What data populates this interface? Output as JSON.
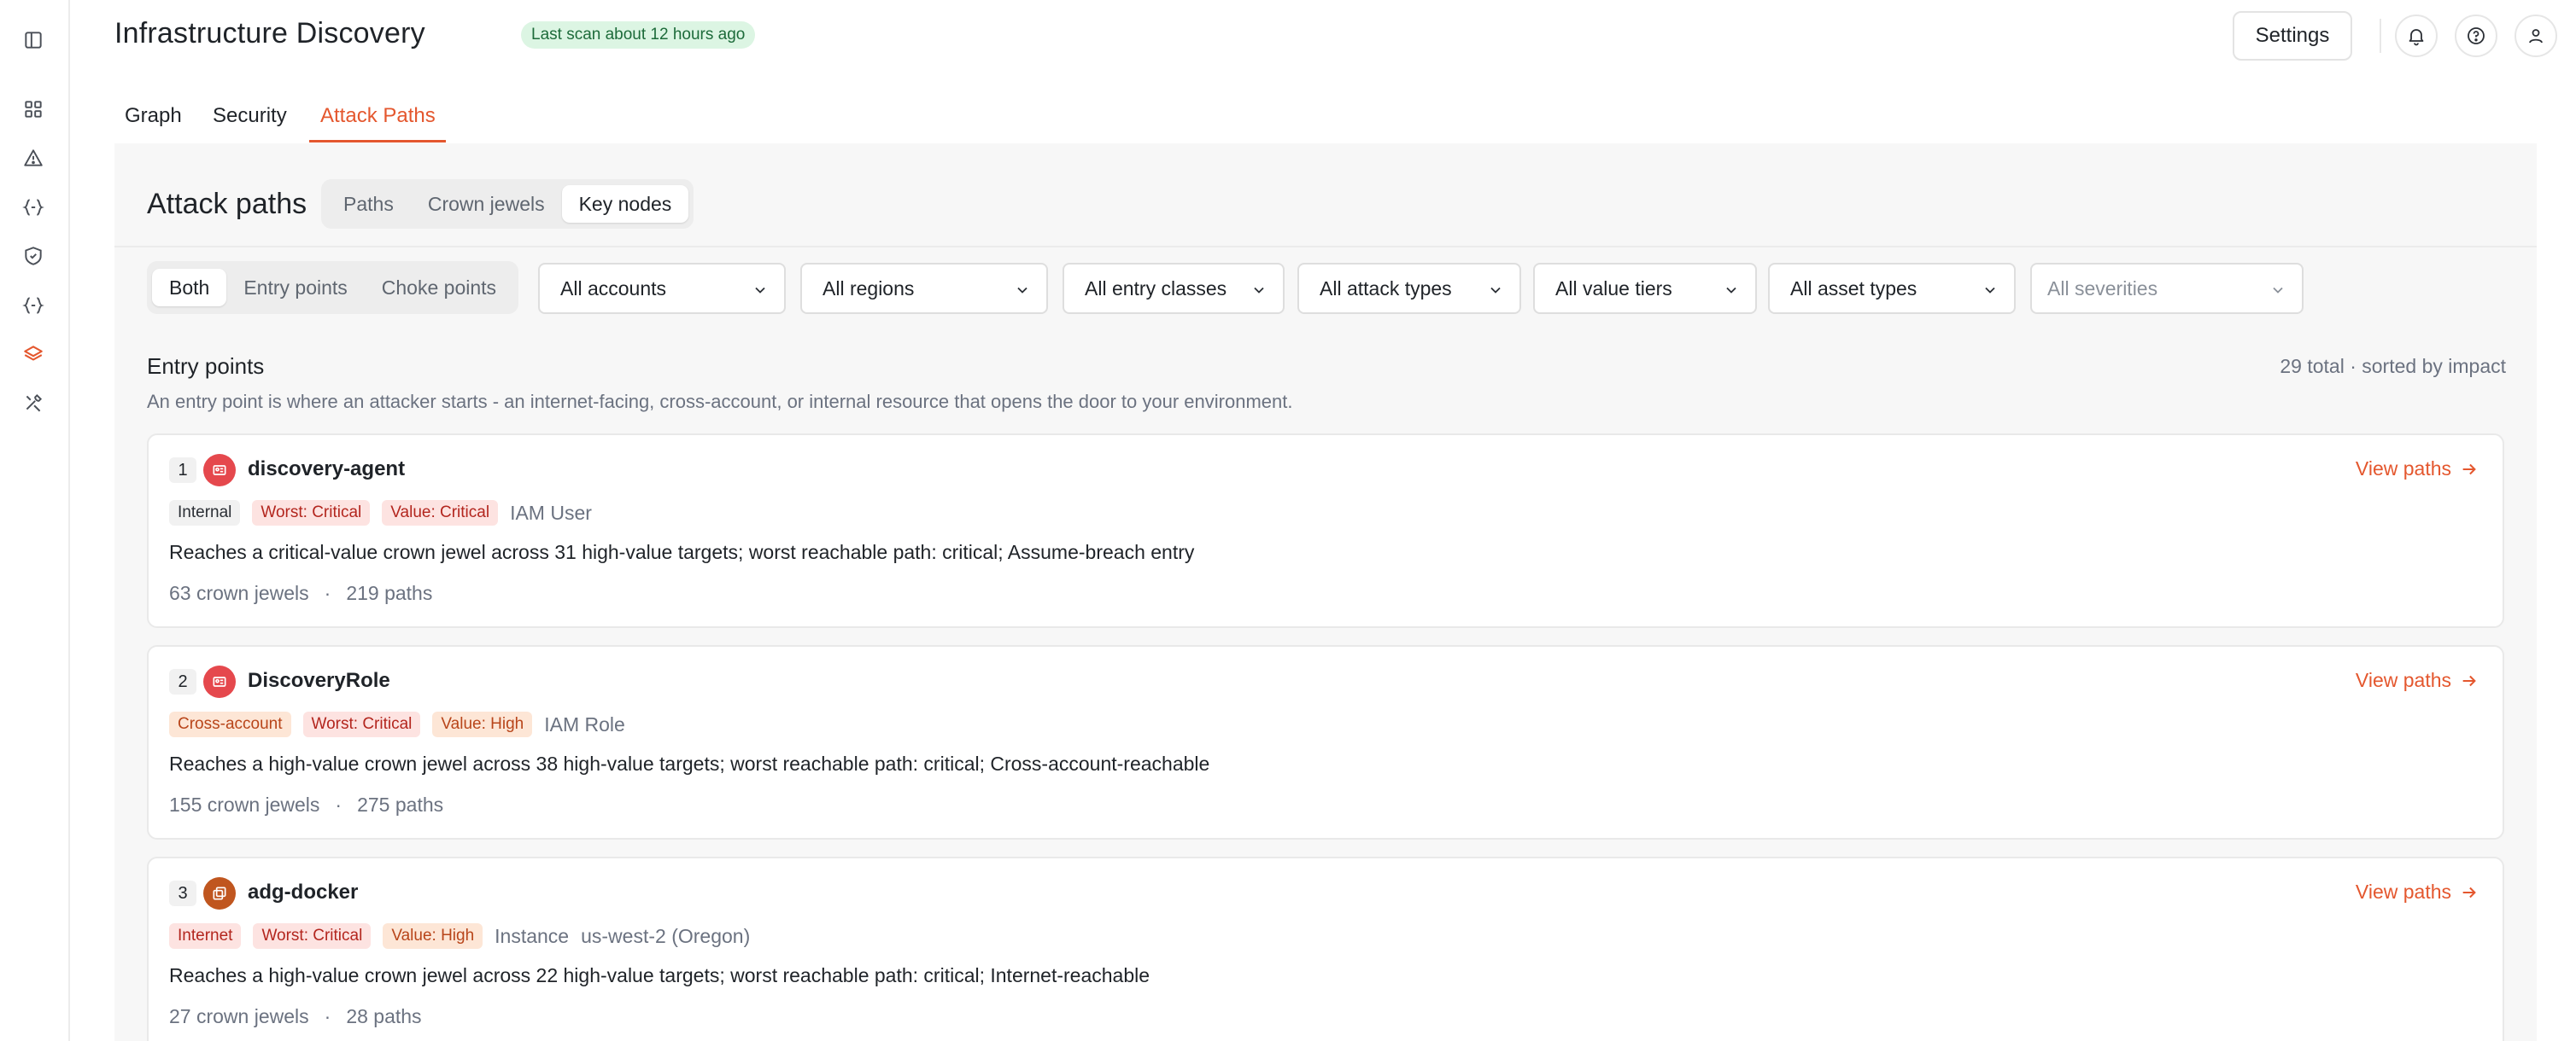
{
  "header": {
    "title": "Infrastructure Discovery",
    "scan_badge": "Last scan about 12 hours ago",
    "settings_label": "Settings"
  },
  "sidebar": {
    "icons": [
      "panel-toggle-icon",
      "dashboard-icon",
      "alert-triangle-icon",
      "code-braces-icon",
      "shield-icon",
      "code-braces-icon",
      "layers-icon",
      "tools-icon"
    ]
  },
  "tabs": [
    {
      "label": "Graph",
      "active": false
    },
    {
      "label": "Security",
      "active": false
    },
    {
      "label": "Attack Paths",
      "active": true
    }
  ],
  "panel": {
    "title": "Attack paths",
    "view_options": [
      {
        "label": "Paths",
        "selected": false
      },
      {
        "label": "Crown jewels",
        "selected": false
      },
      {
        "label": "Key nodes",
        "selected": true
      }
    ],
    "mode_options": [
      {
        "label": "Both",
        "selected": true
      },
      {
        "label": "Entry points",
        "selected": false
      },
      {
        "label": "Choke points",
        "selected": false
      }
    ],
    "filters": [
      {
        "label": "All accounts"
      },
      {
        "label": "All regions"
      },
      {
        "label": "All entry classes"
      },
      {
        "label": "All attack types"
      },
      {
        "label": "All value tiers"
      },
      {
        "label": "All asset types"
      },
      {
        "label": "All severities"
      }
    ]
  },
  "entry_points": {
    "title": "Entry points",
    "description": "An entry point is where an attacker starts - an internet-facing, cross-account, or internal resource that opens the door to your environment.",
    "total": "29 total · sorted by impact",
    "view_label": "View paths",
    "items": [
      {
        "rank": "1",
        "name": "discovery-agent",
        "tags": [
          "Internal",
          "Worst: Critical",
          "Value: Critical"
        ],
        "type": "IAM User",
        "region": "",
        "summary": "Reaches a critical-value crown jewel across 31 high-value targets; worst reachable path: critical; Assume-breach entry",
        "crown_jewels": "63 crown jewels",
        "paths": "219 paths"
      },
      {
        "rank": "2",
        "name": "DiscoveryRole",
        "tags": [
          "Cross-account",
          "Worst: Critical",
          "Value: High"
        ],
        "type": "IAM Role",
        "region": "",
        "summary": "Reaches a high-value crown jewel across 38 high-value targets; worst reachable path: critical; Cross-account-reachable",
        "crown_jewels": "155 crown jewels",
        "paths": "275 paths"
      },
      {
        "rank": "3",
        "name": "adg-docker",
        "tags": [
          "Internet",
          "Worst: Critical",
          "Value: High"
        ],
        "type": "Instance",
        "region": "us-west-2 (Oregon)",
        "summary": "Reaches a high-value crown jewel across 22 high-value targets; worst reachable path: critical; Internet-reachable",
        "crown_jewels": "27 crown jewels",
        "paths": "28 paths"
      }
    ]
  },
  "separator": "·",
  "colors": {
    "accent": "#e4572e",
    "badge_green_bg": "#dcf5e3",
    "critical_red": "#e5484d",
    "instance_brown": "#c0561f"
  }
}
